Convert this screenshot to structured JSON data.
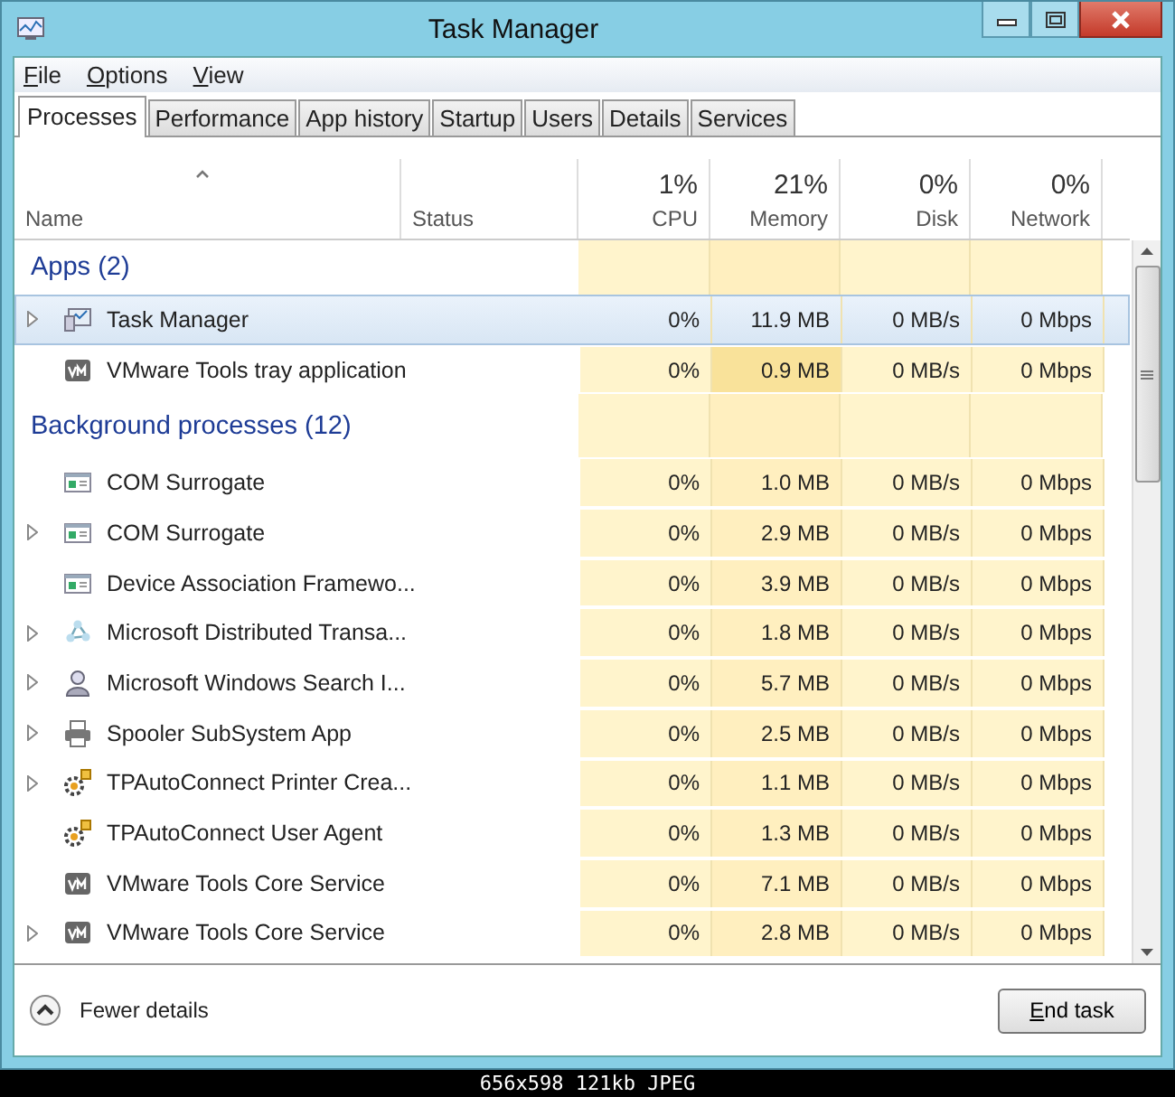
{
  "window": {
    "title": "Task Manager"
  },
  "menu": [
    "File",
    "Options",
    "View"
  ],
  "tabs": [
    {
      "label": "Processes",
      "selected": true
    },
    {
      "label": "Performance",
      "selected": false
    },
    {
      "label": "App history",
      "selected": false
    },
    {
      "label": "Startup",
      "selected": false
    },
    {
      "label": "Users",
      "selected": false
    },
    {
      "label": "Details",
      "selected": false
    },
    {
      "label": "Services",
      "selected": false
    }
  ],
  "columns": [
    {
      "label": "Name",
      "sorted": true
    },
    {
      "label": "Status",
      "sorted": false
    },
    {
      "label": "CPU",
      "usage": "1%",
      "sorted": false
    },
    {
      "label": "Memory",
      "usage": "21%",
      "sorted": false
    },
    {
      "label": "Disk",
      "usage": "0%",
      "sorted": false
    },
    {
      "label": "Network",
      "usage": "0%",
      "sorted": false
    }
  ],
  "groups": [
    {
      "title": "Apps (2)",
      "rows": [
        {
          "name": "Task Manager",
          "kind": "monitor",
          "expandable": true,
          "selected": true,
          "cpu": "0%",
          "memory": "11.9 MB",
          "disk": "0 MB/s",
          "network": "0 Mbps"
        },
        {
          "name": "VMware Tools tray application",
          "kind": "vm",
          "expandable": false,
          "selected": false,
          "cpu": "0%",
          "memory": "0.9 MB",
          "disk": "0 MB/s",
          "network": "0 Mbps"
        }
      ]
    },
    {
      "title": "Background processes (12)",
      "rows": [
        {
          "name": "COM Surrogate",
          "kind": "window",
          "expandable": false,
          "selected": false,
          "cpu": "0%",
          "memory": "1.0 MB",
          "disk": "0 MB/s",
          "network": "0 Mbps"
        },
        {
          "name": "COM Surrogate",
          "kind": "window",
          "expandable": true,
          "selected": false,
          "cpu": "0%",
          "memory": "2.9 MB",
          "disk": "0 MB/s",
          "network": "0 Mbps"
        },
        {
          "name": "Device Association Framewo...",
          "kind": "window",
          "expandable": false,
          "selected": false,
          "cpu": "0%",
          "memory": "3.9 MB",
          "disk": "0 MB/s",
          "network": "0 Mbps"
        },
        {
          "name": "Microsoft Distributed Transa...",
          "kind": "network",
          "expandable": true,
          "selected": false,
          "cpu": "0%",
          "memory": "1.8 MB",
          "disk": "0 MB/s",
          "network": "0 Mbps"
        },
        {
          "name": "Microsoft Windows Search I...",
          "kind": "user",
          "expandable": true,
          "selected": false,
          "cpu": "0%",
          "memory": "5.7 MB",
          "disk": "0 MB/s",
          "network": "0 Mbps"
        },
        {
          "name": "Spooler SubSystem App",
          "kind": "printer",
          "expandable": true,
          "selected": false,
          "cpu": "0%",
          "memory": "2.5 MB",
          "disk": "0 MB/s",
          "network": "0 Mbps"
        },
        {
          "name": "TPAutoConnect Printer Crea...",
          "kind": "gear",
          "expandable": true,
          "selected": false,
          "cpu": "0%",
          "memory": "1.1 MB",
          "disk": "0 MB/s",
          "network": "0 Mbps"
        },
        {
          "name": "TPAutoConnect User Agent",
          "kind": "gear",
          "expandable": false,
          "selected": false,
          "cpu": "0%",
          "memory": "1.3 MB",
          "disk": "0 MB/s",
          "network": "0 Mbps"
        },
        {
          "name": "VMware Tools Core Service",
          "kind": "vm",
          "expandable": false,
          "selected": false,
          "cpu": "0%",
          "memory": "7.1 MB",
          "disk": "0 MB/s",
          "network": "0 Mbps"
        },
        {
          "name": "VMware Tools Core Service",
          "kind": "vm",
          "expandable": true,
          "selected": false,
          "cpu": "0%",
          "memory": "2.8 MB",
          "disk": "0 MB/s",
          "network": "0 Mbps"
        }
      ]
    }
  ],
  "footer": {
    "toggle": "Fewer details",
    "button": "End task"
  },
  "image_caption": "656x598 121kb JPEG"
}
